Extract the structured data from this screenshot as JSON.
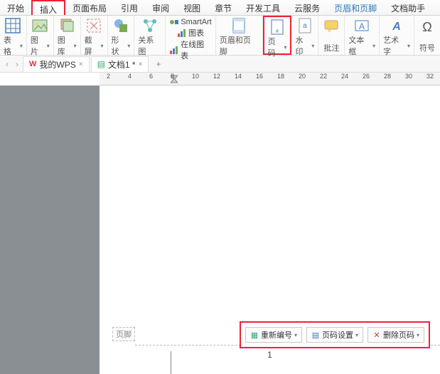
{
  "tabs": {
    "items": [
      "开始",
      "插入",
      "页面布局",
      "引用",
      "审阅",
      "视图",
      "章节",
      "开发工具",
      "云服务",
      "页眉和页脚",
      "文档助手"
    ],
    "active_index": 1
  },
  "ribbon": {
    "table": "表格",
    "picture": "图片",
    "gallery": "图库",
    "screenshot": "截屏",
    "shapes": "形状",
    "relations": "关系图",
    "smartart": "SmartArt",
    "chart": "图表",
    "online_chart": "在线图表",
    "header_footer": "页眉和页脚",
    "page_number": "页码",
    "watermark": "水印",
    "comment": "批注",
    "textbox": "文本框",
    "wordart": "艺术字",
    "symbol": "符号"
  },
  "doc_tabs": {
    "wps": "我的WPS",
    "doc1": "文档1 *"
  },
  "ruler_ticks": [
    "2",
    "4",
    "6",
    "8",
    "10",
    "12",
    "14",
    "16",
    "18",
    "20",
    "22",
    "24",
    "26",
    "28",
    "30",
    "32"
  ],
  "footer": {
    "label": "页脚",
    "page_number": "1",
    "renumber": "重新编号",
    "page_setup": "页码设置",
    "delete": "删除页码"
  }
}
